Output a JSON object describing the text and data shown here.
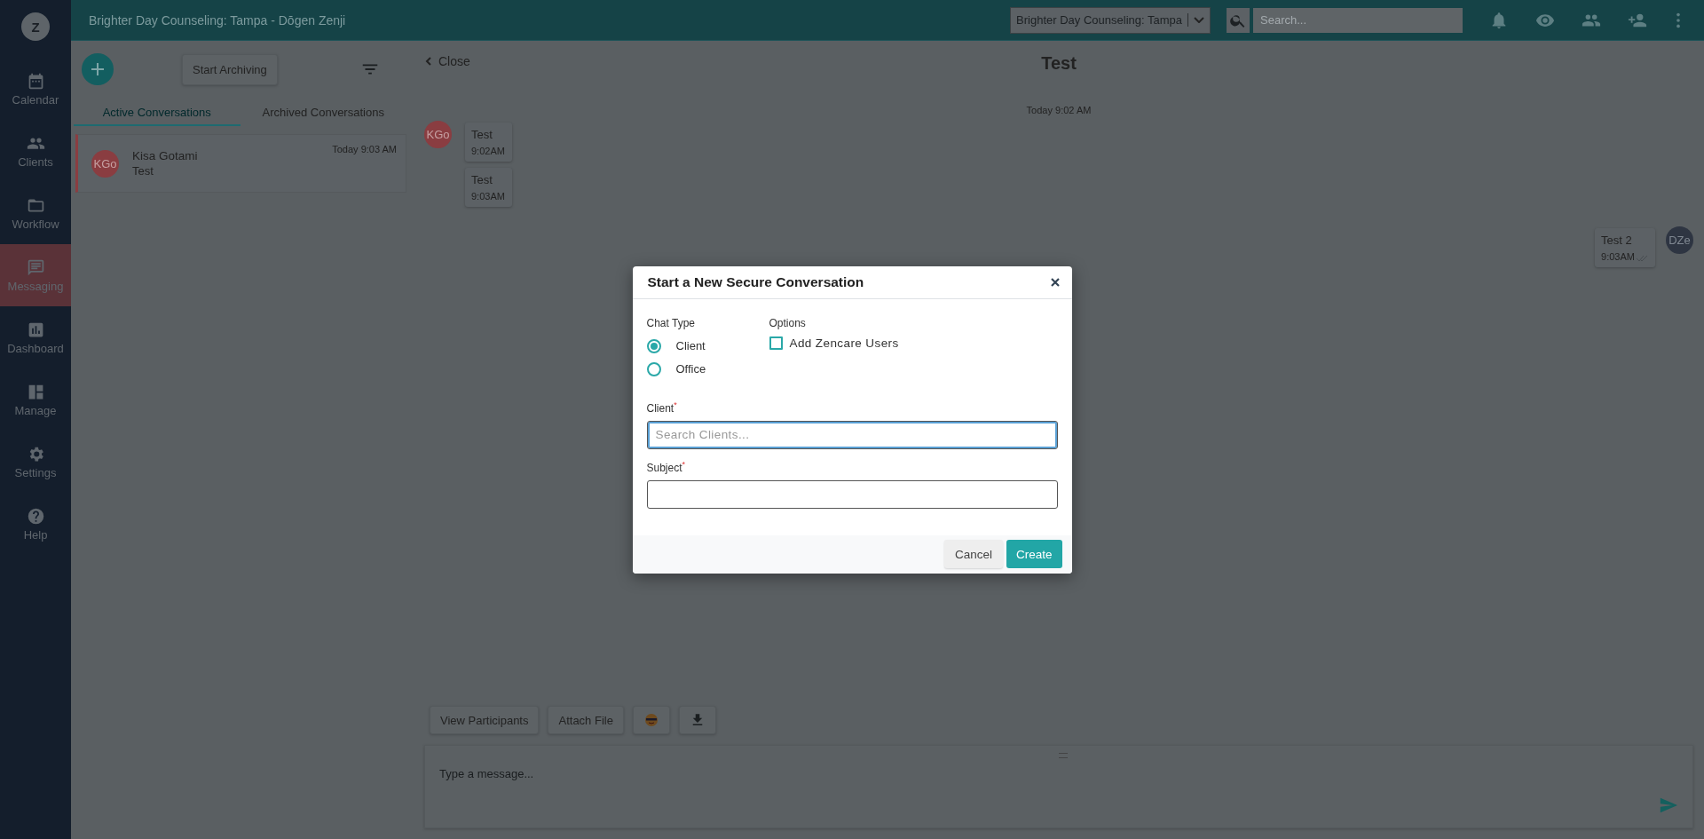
{
  "app_logo": "Z",
  "topbar": {
    "title": "Brighter Day Counseling: Tampa - Dōgen Zenji",
    "location_select": "Brighter Day Counseling: Tampa",
    "search": {
      "placeholder": "Search..."
    }
  },
  "sidebar": {
    "items": [
      {
        "label": "Calendar",
        "selected": false
      },
      {
        "label": "Clients",
        "selected": false
      },
      {
        "label": "Workflow",
        "selected": false
      },
      {
        "label": "Messaging",
        "selected": true
      },
      {
        "label": "Dashboard",
        "selected": false
      },
      {
        "label": "Manage",
        "selected": false
      },
      {
        "label": "Settings",
        "selected": false
      },
      {
        "label": "Help",
        "selected": false
      }
    ]
  },
  "conversations_panel": {
    "archive_button": "Start Archiving",
    "tabs": [
      {
        "label": "Active Conversations",
        "selected": true
      },
      {
        "label": "Archived Conversations",
        "selected": false
      }
    ],
    "items": [
      {
        "initials": "KGo",
        "name": "Kisa Gotami",
        "preview": "Test",
        "time": "Today 9:03 AM",
        "selected": true,
        "color": "#8a3d41"
      }
    ]
  },
  "chat": {
    "close": "Close",
    "title": "Test",
    "date_divider": "Today 9:02 AM",
    "messages": [
      {
        "kind": "incoming",
        "avatar": "KGo",
        "color": "#8a3d41",
        "text": "Test",
        "time": "9:02AM"
      },
      {
        "kind": "incoming",
        "text": "Test",
        "time": "9:03AM"
      },
      {
        "kind": "outgoing",
        "avatar": "DZe",
        "color": "#2e3542",
        "text": "Test 2",
        "time": "9:03AM"
      }
    ],
    "toolbar": [
      "View Participants",
      "Attach File"
    ],
    "composer": {
      "placeholder": "Type a message..."
    }
  },
  "dialog": {
    "title": "Start a New Secure Conversation",
    "chat_type_label": "Chat Type",
    "chat_types": [
      {
        "label": "Client",
        "selected": true
      },
      {
        "label": "Office",
        "selected": false
      }
    ],
    "options_label": "Options",
    "options": [
      {
        "label": "Add Zencare Users",
        "checked": false
      }
    ],
    "fields": [
      {
        "label": "Client$^{*}$",
        "placeholder": "Search Clients...",
        "focused": true
      },
      {
        "label": "Subject$^{*}$",
        "focused": false
      }
    ],
    "cancel": "Cancel",
    "create": "Create"
  }
}
